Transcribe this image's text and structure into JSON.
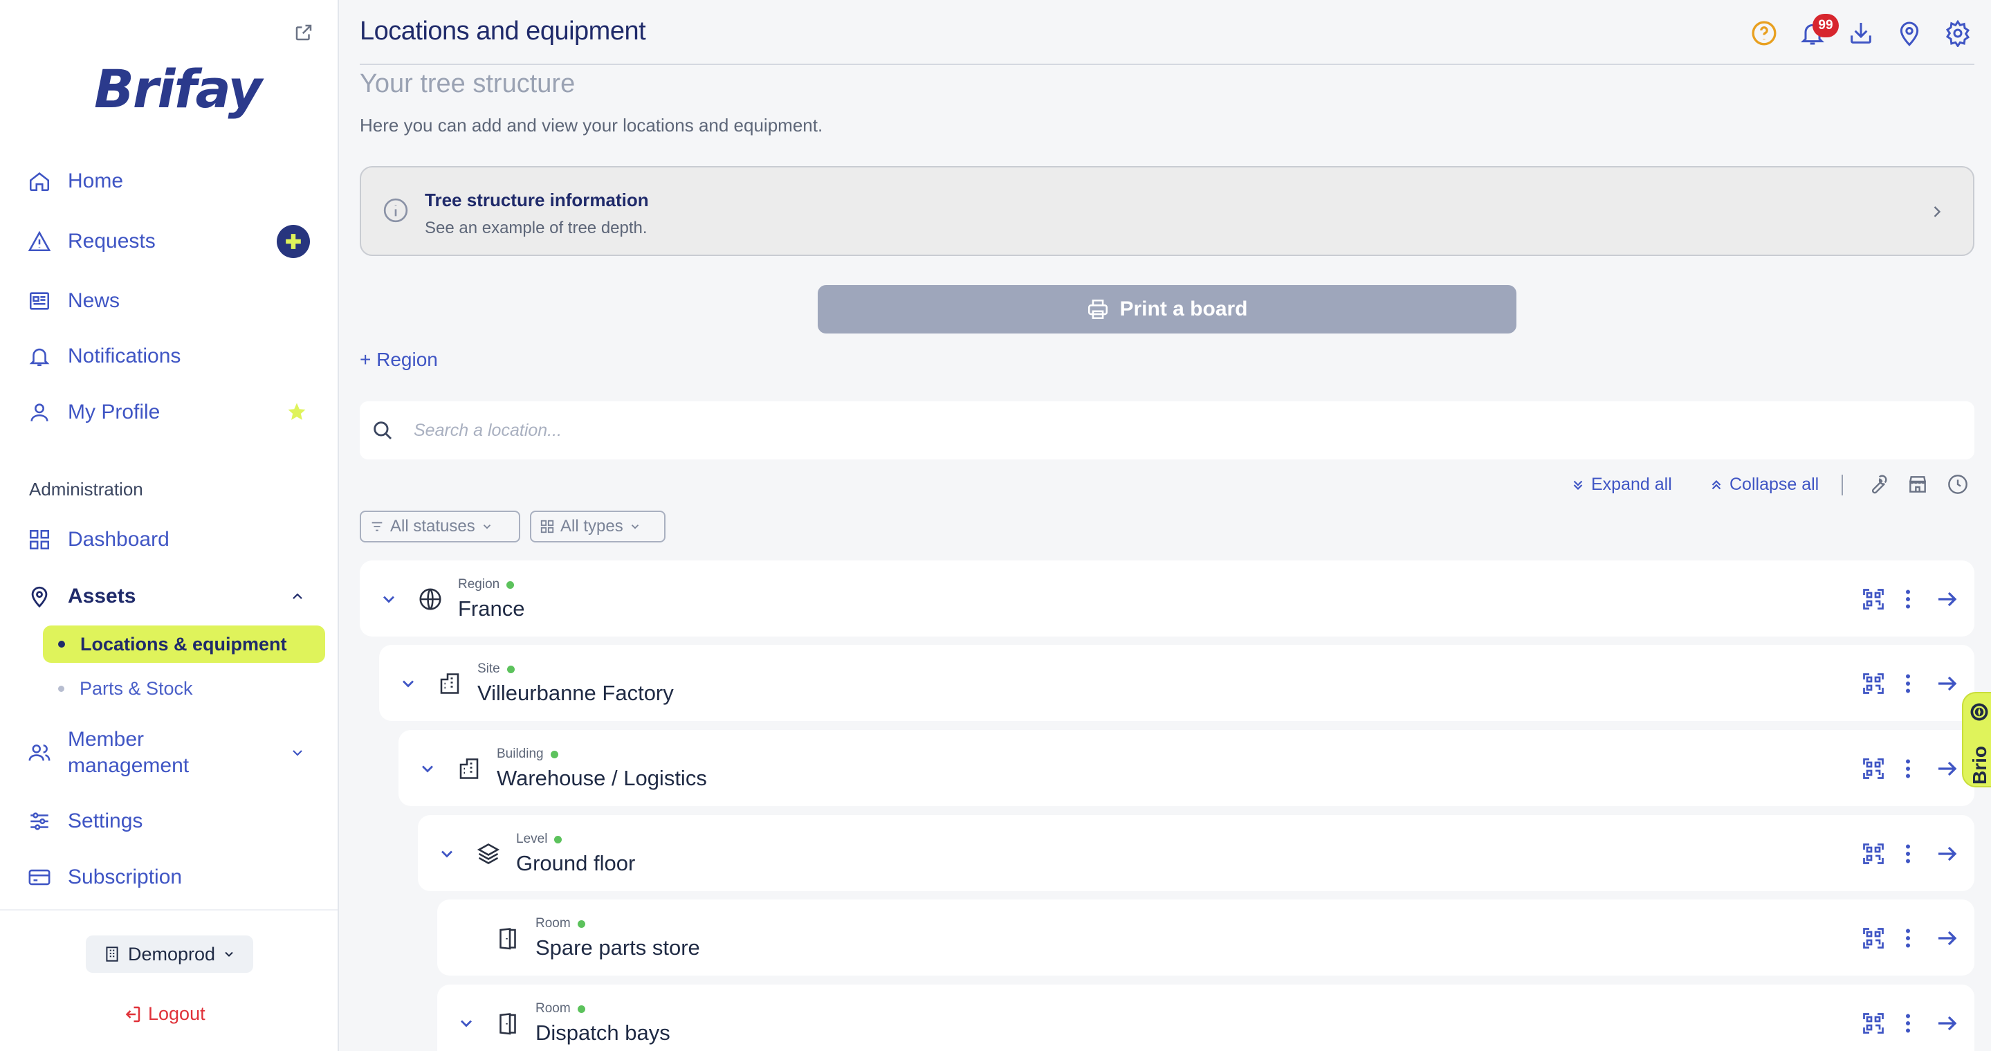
{
  "app": {
    "name": "Brifay"
  },
  "sidebar": {
    "items": [
      {
        "label": "Home",
        "icon": "home-icon"
      },
      {
        "label": "Requests",
        "icon": "warning-triangle-icon"
      },
      {
        "label": "News",
        "icon": "newspaper-icon"
      },
      {
        "label": "Notifications",
        "icon": "bell-icon"
      },
      {
        "label": "My Profile",
        "icon": "user-icon"
      }
    ],
    "section_label": "Administration",
    "admin_items": [
      {
        "label": "Dashboard",
        "icon": "grid-icon"
      },
      {
        "label": "Assets",
        "icon": "map-pin-icon"
      }
    ],
    "assets_sub": [
      {
        "label": "Locations & equipment",
        "active": true
      },
      {
        "label": "Parts & Stock",
        "active": false
      }
    ],
    "bottom_items": [
      {
        "label": "Member management",
        "icon": "users-icon"
      },
      {
        "label": "Settings",
        "icon": "sliders-icon"
      },
      {
        "label": "Subscription",
        "icon": "credit-card-icon"
      }
    ],
    "workspace": "Demoprod",
    "logout": "Logout"
  },
  "header": {
    "title": "Locations and equipment",
    "notification_count": "99"
  },
  "main": {
    "subtitle": "Your tree structure",
    "description": "Here you can add and view your locations and equipment.",
    "info_card": {
      "title": "Tree structure information",
      "subtitle": "See an example of tree depth."
    },
    "print_button": "Print a board",
    "add_region": "+ Region",
    "search_placeholder": "Search a location...",
    "expand_all": "Expand all",
    "collapse_all": "Collapse all",
    "filters": {
      "statuses": "All statuses",
      "types": "All types"
    }
  },
  "tree": [
    {
      "type": "Region",
      "name": "France",
      "icon": "globe-icon",
      "status_color": "#5cc25c",
      "expandable": true
    },
    {
      "type": "Site",
      "name": "Villeurbanne Factory",
      "icon": "building-icon",
      "status_color": "#5cc25c",
      "expandable": true
    },
    {
      "type": "Building",
      "name": "Warehouse / Logistics",
      "icon": "building-icon",
      "status_color": "#5cc25c",
      "expandable": true
    },
    {
      "type": "Level",
      "name": "Ground floor",
      "icon": "layers-icon",
      "status_color": "#5cc25c",
      "expandable": true
    },
    {
      "type": "Room",
      "name": "Spare parts store",
      "icon": "door-icon",
      "status_color": "#5cc25c",
      "expandable": false
    },
    {
      "type": "Room",
      "name": "Dispatch bays",
      "icon": "door-icon",
      "status_color": "#5cc25c",
      "expandable": true
    }
  ],
  "assistant": {
    "label": "Brio"
  },
  "colors": {
    "accent": "#3f55c4",
    "navy": "#1f2a6a",
    "lime": "#dff35b",
    "danger": "#d7262e",
    "status_ok": "#5cc25c"
  }
}
